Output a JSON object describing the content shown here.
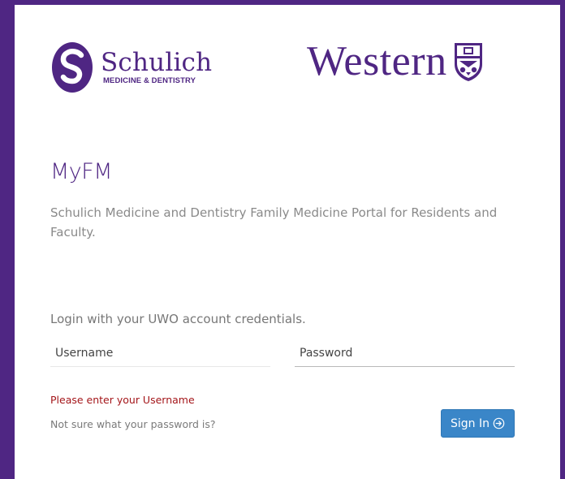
{
  "brand": {
    "schulich_name": "Schulich",
    "schulich_subtitle": "MEDICINE & DENTISTRY",
    "western_name": "Western",
    "logo_icon": "schulich-s-logo-icon",
    "crest_icon": "western-crest-icon"
  },
  "page": {
    "title": "MyFM",
    "subtitle": "Schulich Medicine and Dentistry Family Medicine Portal for Residents and Faculty."
  },
  "login": {
    "hint": "Login with your UWO account credentials.",
    "username_placeholder": "Username",
    "username_value": "",
    "password_placeholder": "Password",
    "password_value": "",
    "error_message": "Please enter your Username",
    "forgot_link": "Not sure what your password is?",
    "sign_in_label": "Sign In",
    "sign_in_icon": "arrow-circle-right-icon"
  },
  "colors": {
    "brand_purple": "#4f2683",
    "button_blue": "#3a86c8",
    "error_red": "#a4161a",
    "muted_text": "#8a8a8a"
  }
}
